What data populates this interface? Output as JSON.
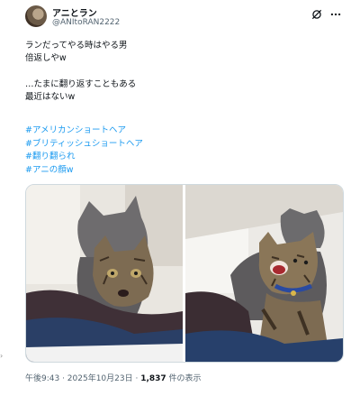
{
  "post": {
    "display_name": "アニとラン",
    "handle": "@ANItoRAN2222",
    "body": "ランだってやる時はやる男\n倍返しやw\n\n…たまに翻り返すこともある\n最近はないw",
    "hashtags": [
      "#アメリカンショートヘア",
      "#ブリティッシュショートヘア",
      "#翻り翻られ",
      "#アニの顔w"
    ]
  },
  "meta": {
    "time_date": "午後9:43 · 2025年10月23日 · ",
    "views_count": "1,837",
    "views_suffix": " 件の表示"
  },
  "icons": {
    "grok": "grok-icon",
    "more": "more-icon"
  },
  "colors": {
    "link": "#1d9bf0",
    "secondary": "#536471"
  },
  "left_marker": "›"
}
